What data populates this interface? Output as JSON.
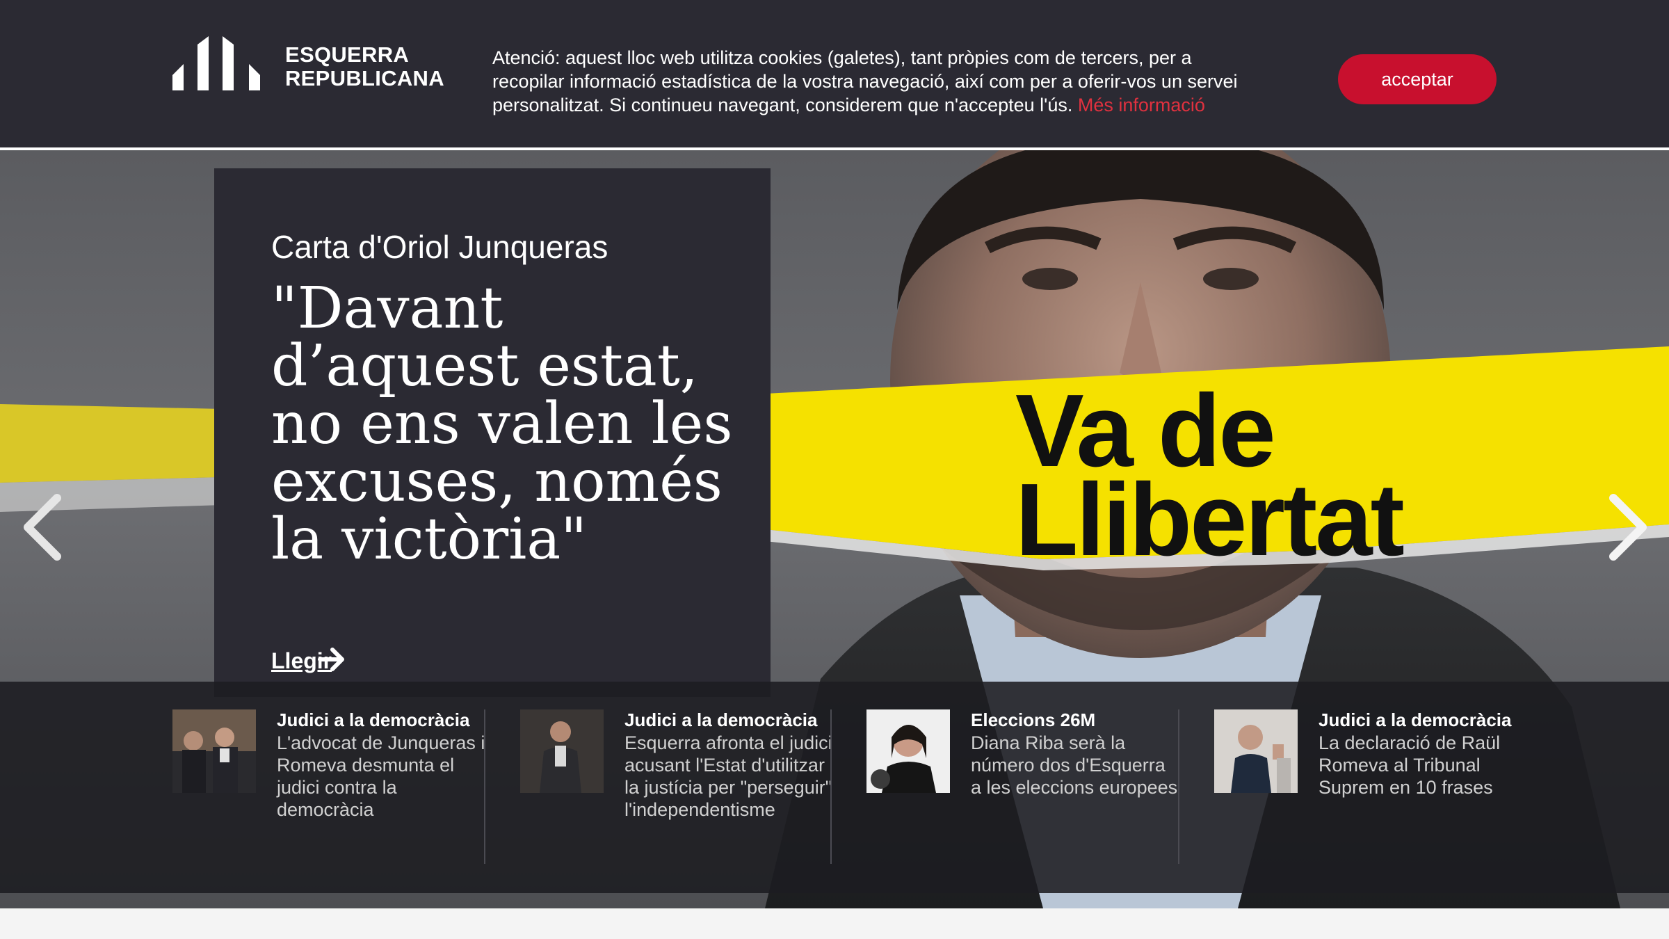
{
  "header": {
    "logo_line1": "ESQUERRA",
    "logo_line2": "REPUBLICANA"
  },
  "cookie": {
    "text": "Atenció: aquest lloc web utilitza cookies (galetes), tant pròpies com de tercers, per a recopilar informació estadística de la vostra navegació, així com per a oferir-vos un servei personalitzat. Si continueu navegant, considerem que n'accepteu l'ús.",
    "link_label": "Més informació",
    "accept_label": "acceptar"
  },
  "hero": {
    "kicker": "Carta d'Oriol Junqueras",
    "quote": "\"Davant d’aquest estat, no ens valen les excuses, només la victòria\"",
    "read_label": "Llegir",
    "slogan_line1": "Va de",
    "slogan_line2": "Llibertat"
  },
  "news": [
    {
      "category": "Judici a la democràcia",
      "title": "L'advocat de Junqueras i Romeva desmunta el judici contra la democràcia"
    },
    {
      "category": "Judici a la democràcia",
      "title": "Esquerra afronta el judici acusant l'Estat d'utilitzar la justícia per \"perseguir\" l'independentisme"
    },
    {
      "category": "Eleccions 26M",
      "title": "Diana Riba serà la número dos d'Esquerra a les eleccions europees"
    },
    {
      "category": "Judici a la democràcia",
      "title": "La declaració de Raül Romeva al Tribunal Suprem en 10 frases"
    }
  ],
  "colors": {
    "dark_panel": "#2b2a33",
    "brand_red": "#c8102e",
    "link_red": "#e0313f",
    "slogan_yellow": "#f5e100"
  },
  "icons": [
    "logo-bars-icon",
    "arrow-right-icon",
    "chevron-left-icon",
    "chevron-right-icon"
  ]
}
